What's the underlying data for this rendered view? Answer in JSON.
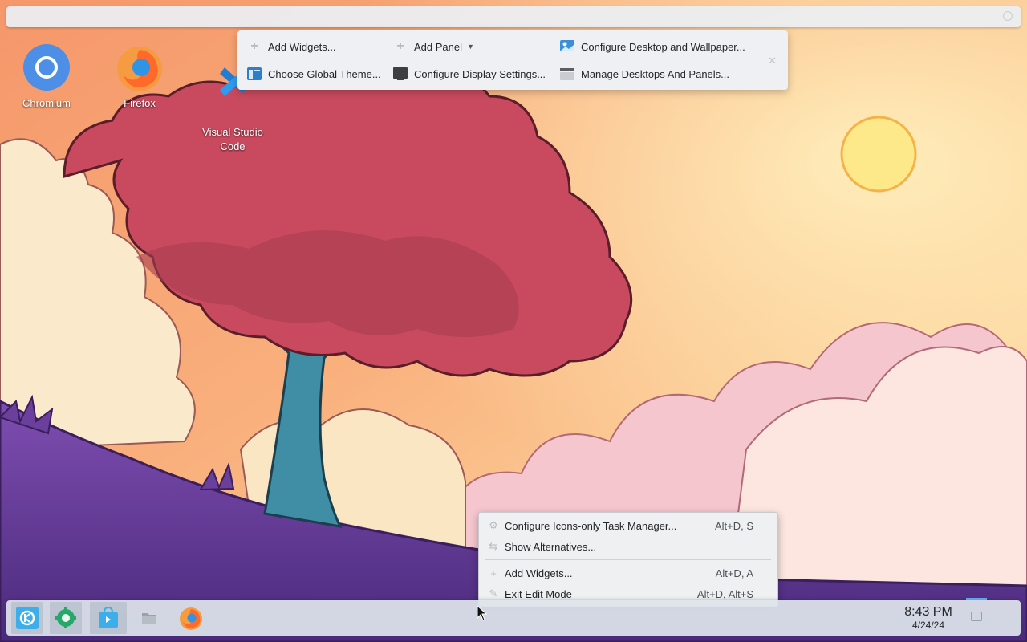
{
  "desktop": {
    "icons": [
      {
        "label": "Chromium",
        "icon": "chromium-icon"
      },
      {
        "label": "Firefox",
        "icon": "firefox-icon"
      },
      {
        "label": "Visual Studio\nCode",
        "icon": "vscode-icon"
      }
    ]
  },
  "toolbox": {
    "add_widgets": "Add Widgets...",
    "add_panel": "Add Panel",
    "configure_desktop": "Configure Desktop and Wallpaper...",
    "choose_global_theme": "Choose Global Theme...",
    "configure_display": "Configure Display Settings...",
    "manage_desktops": "Manage Desktops And Panels..."
  },
  "context_menu": {
    "items": [
      {
        "label": "Configure Icons-only Task Manager...",
        "shortcut": "Alt+D, S",
        "icon": "configure-icon"
      },
      {
        "label": "Show Alternatives...",
        "shortcut": "",
        "icon": "alternatives-icon"
      },
      {
        "label": "Add Widgets...",
        "shortcut": "Alt+D, A",
        "icon": "plus-icon"
      },
      {
        "label": "Exit Edit Mode",
        "shortcut": "Alt+D, Alt+S",
        "icon": "pencil-icon"
      }
    ]
  },
  "panel": {
    "tasks": [
      "kde-launcher-icon",
      "discover-settings-icon",
      "discover-store-icon",
      "dolphin-files-icon",
      "firefox-icon"
    ],
    "clock_time": "8:43 PM",
    "clock_date": "4/24/24"
  },
  "colors": {
    "sky_top": "#f9a36f",
    "sky_glow": "#fde6a8",
    "tree_foliage": "#c8485a",
    "tree_trunk": "#3f8ea6",
    "hill": "#6a3f9a",
    "accent": "#3daee9"
  }
}
